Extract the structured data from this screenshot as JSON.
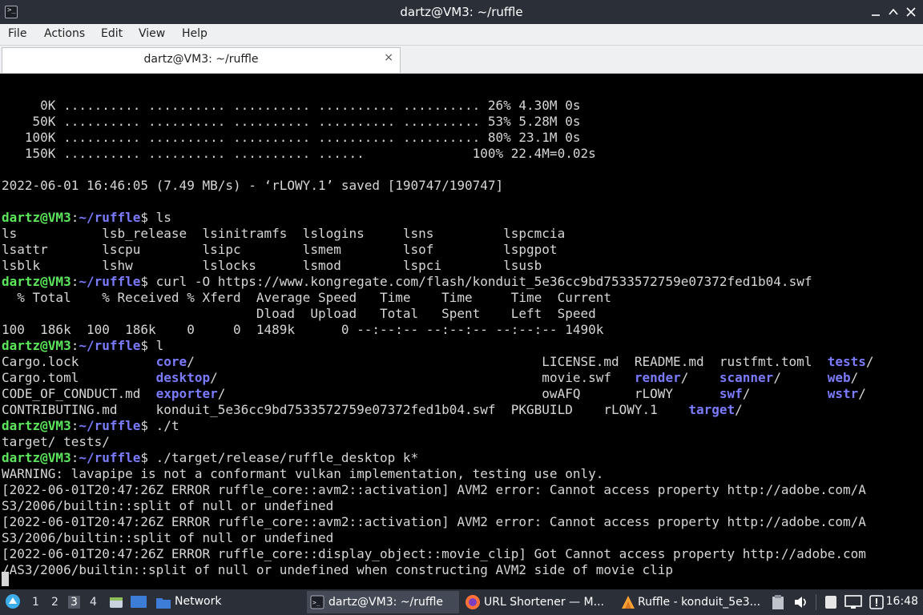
{
  "window": {
    "title": "dartz@VM3: ~/ruffle"
  },
  "menu": [
    "File",
    "Actions",
    "Edit",
    "View",
    "Help"
  ],
  "tab": {
    "label": "dartz@VM3: ~/ruffle",
    "close": "×"
  },
  "colors": {
    "prompt_user": "#5ce65c",
    "prompt_path": "#7b7bff",
    "dir": "#7b7bff",
    "text": "#d6d6d6"
  },
  "terminal": {
    "lines": [
      {
        "segs": [
          {
            "t": ""
          }
        ]
      },
      {
        "segs": [
          {
            "t": "     0K .......... .......... .......... .......... .......... 26% 4.30M 0s"
          }
        ]
      },
      {
        "segs": [
          {
            "t": "    50K .......... .......... .......... .......... .......... 53% 5.28M 0s"
          }
        ]
      },
      {
        "segs": [
          {
            "t": "   100K .......... .......... .......... .......... .......... 80% 23.1M 0s"
          }
        ]
      },
      {
        "segs": [
          {
            "t": "   150K .......... .......... .......... ......              100% 22.4M=0.02s"
          }
        ]
      },
      {
        "segs": [
          {
            "t": ""
          }
        ]
      },
      {
        "segs": [
          {
            "t": "2022-06-01 16:46:05 (7.49 MB/s) - ‘rLOWY.1’ saved [190747/190747]"
          }
        ]
      },
      {
        "segs": [
          {
            "t": ""
          }
        ]
      },
      {
        "segs": [
          {
            "t": "dartz@VM3",
            "c": "user"
          },
          {
            "t": ":"
          },
          {
            "t": "~/ruffle",
            "c": "path"
          },
          {
            "t": "$ ls"
          }
        ]
      },
      {
        "segs": [
          {
            "t": "ls           lsb_release  lsinitramfs  lslogins     lsns         lspcmcia"
          }
        ]
      },
      {
        "segs": [
          {
            "t": "lsattr       lscpu        lsipc        lsmem        lsof         lspgpot"
          }
        ]
      },
      {
        "segs": [
          {
            "t": "lsblk        lshw         lslocks      lsmod        lspci        lsusb"
          }
        ]
      },
      {
        "segs": [
          {
            "t": "dartz@VM3",
            "c": "user"
          },
          {
            "t": ":"
          },
          {
            "t": "~/ruffle",
            "c": "path"
          },
          {
            "t": "$ curl -O https://www.kongregate.com/flash/konduit_5e36cc9bd7533572759e07372fed1b04.swf"
          }
        ]
      },
      {
        "segs": [
          {
            "t": "  % Total    % Received % Xferd  Average Speed   Time    Time     Time  Current"
          }
        ]
      },
      {
        "segs": [
          {
            "t": "                                 Dload  Upload   Total   Spent    Left  Speed"
          }
        ]
      },
      {
        "segs": [
          {
            "t": "100  186k  100  186k    0     0  1489k      0 --:--:-- --:--:-- --:--:-- 1490k"
          }
        ]
      },
      {
        "segs": [
          {
            "t": "dartz@VM3",
            "c": "user"
          },
          {
            "t": ":"
          },
          {
            "t": "~/ruffle",
            "c": "path"
          },
          {
            "t": "$ l"
          }
        ]
      },
      {
        "segs": [
          {
            "t": "Cargo.lock          "
          },
          {
            "t": "core",
            "c": "dir"
          },
          {
            "t": "/                                             LICENSE.md  README.md  rustfmt.toml  "
          },
          {
            "t": "tests",
            "c": "dir"
          },
          {
            "t": "/"
          }
        ]
      },
      {
        "segs": [
          {
            "t": "Cargo.toml          "
          },
          {
            "t": "desktop",
            "c": "dir"
          },
          {
            "t": "/                                          movie.swf   "
          },
          {
            "t": "render",
            "c": "dir"
          },
          {
            "t": "/    "
          },
          {
            "t": "scanner",
            "c": "dir"
          },
          {
            "t": "/      "
          },
          {
            "t": "web",
            "c": "dir"
          },
          {
            "t": "/"
          }
        ]
      },
      {
        "segs": [
          {
            "t": "CODE_OF_CONDUCT.md  "
          },
          {
            "t": "exporter",
            "c": "dir"
          },
          {
            "t": "/                                         owAFQ       rLOWY      "
          },
          {
            "t": "swf",
            "c": "dir"
          },
          {
            "t": "/          "
          },
          {
            "t": "wstr",
            "c": "dir"
          },
          {
            "t": "/"
          }
        ]
      },
      {
        "segs": [
          {
            "t": "CONTRIBUTING.md     konduit_5e36cc9bd7533572759e07372fed1b04.swf  PKGBUILD    rLOWY.1    "
          },
          {
            "t": "target",
            "c": "dir"
          },
          {
            "t": "/"
          }
        ]
      },
      {
        "segs": [
          {
            "t": "dartz@VM3",
            "c": "user"
          },
          {
            "t": ":"
          },
          {
            "t": "~/ruffle",
            "c": "path"
          },
          {
            "t": "$ ./t"
          }
        ]
      },
      {
        "segs": [
          {
            "t": "target/ tests/"
          }
        ]
      },
      {
        "segs": [
          {
            "t": "dartz@VM3",
            "c": "user"
          },
          {
            "t": ":"
          },
          {
            "t": "~/ruffle",
            "c": "path"
          },
          {
            "t": "$ ./target/release/ruffle_desktop k*"
          }
        ]
      },
      {
        "segs": [
          {
            "t": "WARNING: lavapipe is not a conformant vulkan implementation, testing use only."
          }
        ]
      },
      {
        "segs": [
          {
            "t": "[2022-06-01T20:47:26Z ERROR ruffle_core::avm2::activation] AVM2 error: Cannot access property http://adobe.com/A"
          }
        ]
      },
      {
        "segs": [
          {
            "t": "S3/2006/builtin::split of null or undefined"
          }
        ]
      },
      {
        "segs": [
          {
            "t": "[2022-06-01T20:47:26Z ERROR ruffle_core::avm2::activation] AVM2 error: Cannot access property http://adobe.com/A"
          }
        ]
      },
      {
        "segs": [
          {
            "t": "S3/2006/builtin::split of null or undefined"
          }
        ]
      },
      {
        "segs": [
          {
            "t": "[2022-06-01T20:47:26Z ERROR ruffle_core::display_object::movie_clip] Got Cannot access property http://adobe.com"
          }
        ]
      },
      {
        "segs": [
          {
            "t": "/AS3/2006/builtin::split of null or undefined when constructing AVM2 side of movie clip"
          }
        ]
      }
    ]
  },
  "taskbar": {
    "workspaces": [
      "1",
      "2",
      "3",
      "4"
    ],
    "active_workspace": "3",
    "places_label": "Network",
    "tasks": [
      {
        "label": "dartz@VM3: ~/ruffle",
        "icon": "terminal-icon",
        "active": true
      },
      {
        "label": "URL Shortener — M...",
        "icon": "firefox-icon",
        "active": false
      },
      {
        "label": "Ruffle - konduit_5e3...",
        "icon": "ruffle-icon",
        "active": false
      }
    ],
    "clock": "16:48"
  }
}
